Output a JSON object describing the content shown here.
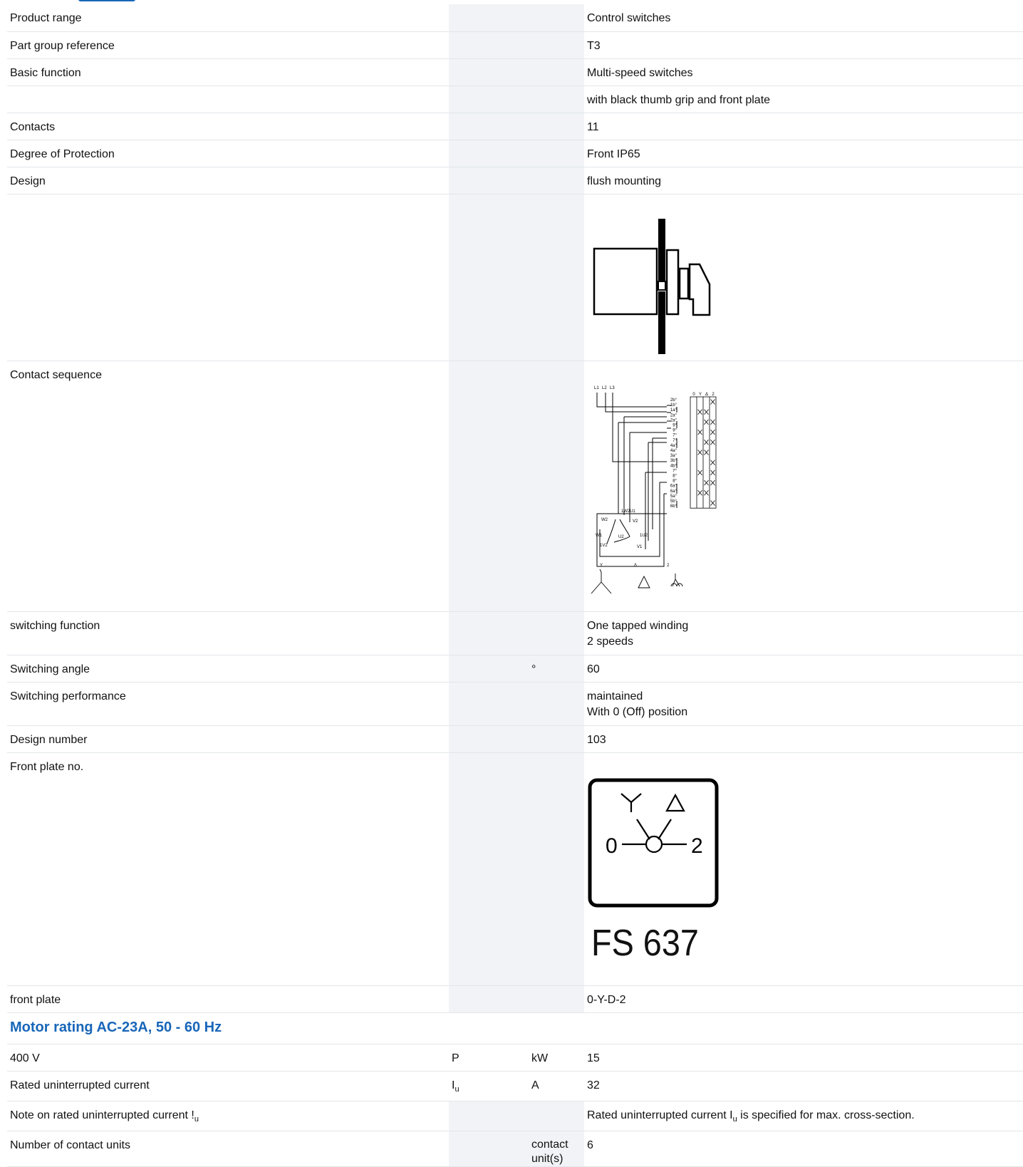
{
  "rows": [
    {
      "label": "Product range",
      "value": "Control switches"
    },
    {
      "label": "Part group reference",
      "value": "T3"
    },
    {
      "label": "Basic function",
      "value": "Multi-speed switches"
    },
    {
      "label": "",
      "value": "with black thumb grip and front plate"
    },
    {
      "label": "Contacts",
      "value": "11"
    },
    {
      "label": "Degree of Protection",
      "value": "Front IP65"
    },
    {
      "label": "Design",
      "value": "flush mounting"
    },
    {
      "label": "Contact sequence"
    },
    {
      "label": "switching function",
      "value": "One tapped winding\n2 speeds"
    },
    {
      "label": "Switching angle",
      "unit": "°",
      "value": "60"
    },
    {
      "label": "Switching performance",
      "value": "maintained\nWith 0 (Off) position"
    },
    {
      "label": "Design number",
      "value": "103"
    },
    {
      "label": "Front plate no."
    },
    {
      "label": "front plate",
      "value": "0-Y-D-2"
    }
  ],
  "section_motor": {
    "title": "Motor rating AC-23A, 50 - 60 Hz",
    "rows": [
      {
        "label": "400 V",
        "symbol": "P",
        "unit": "kW",
        "value": "15"
      },
      {
        "label": "Rated uninterrupted current",
        "symbol": "I",
        "symbol_sub": "u",
        "unit": "A",
        "value": "32"
      },
      {
        "label": "Note on rated uninterrupted current !",
        "label_sub": "u",
        "value_pre": "Rated uninterrupted current I",
        "value_sub": "u",
        "value_post": " is specified for max. cross-section."
      },
      {
        "label": "Number of contact units",
        "unit": "contact unit(s)",
        "value": "6"
      }
    ]
  },
  "front_plate_graphic": {
    "pos_left": "0",
    "pos_right": "2",
    "code": "FS 637"
  },
  "diagram_labels": {
    "terminals": [
      "L1",
      "L2",
      "L3"
    ],
    "positions": [
      "0",
      "Y",
      "Δ",
      "2"
    ],
    "contacts": [
      "2b",
      "1b",
      "1a",
      "2a",
      "2a",
      "9",
      "9",
      "7",
      "7",
      "4a",
      "4a",
      "3a",
      "3b",
      "4b",
      "7",
      "8",
      "8",
      "6a",
      "6a",
      "5a",
      "5b",
      "6b"
    ],
    "windings": [
      "1W2",
      "U1",
      "W2",
      "V2",
      "W1",
      "U2",
      "1U2",
      "1V2",
      "V1"
    ],
    "bottom": [
      "Y",
      "Δ",
      "2"
    ]
  },
  "colors": {
    "accent": "#1866b9",
    "shade": "#f1f3f6",
    "rule": "#e3e6ea"
  }
}
